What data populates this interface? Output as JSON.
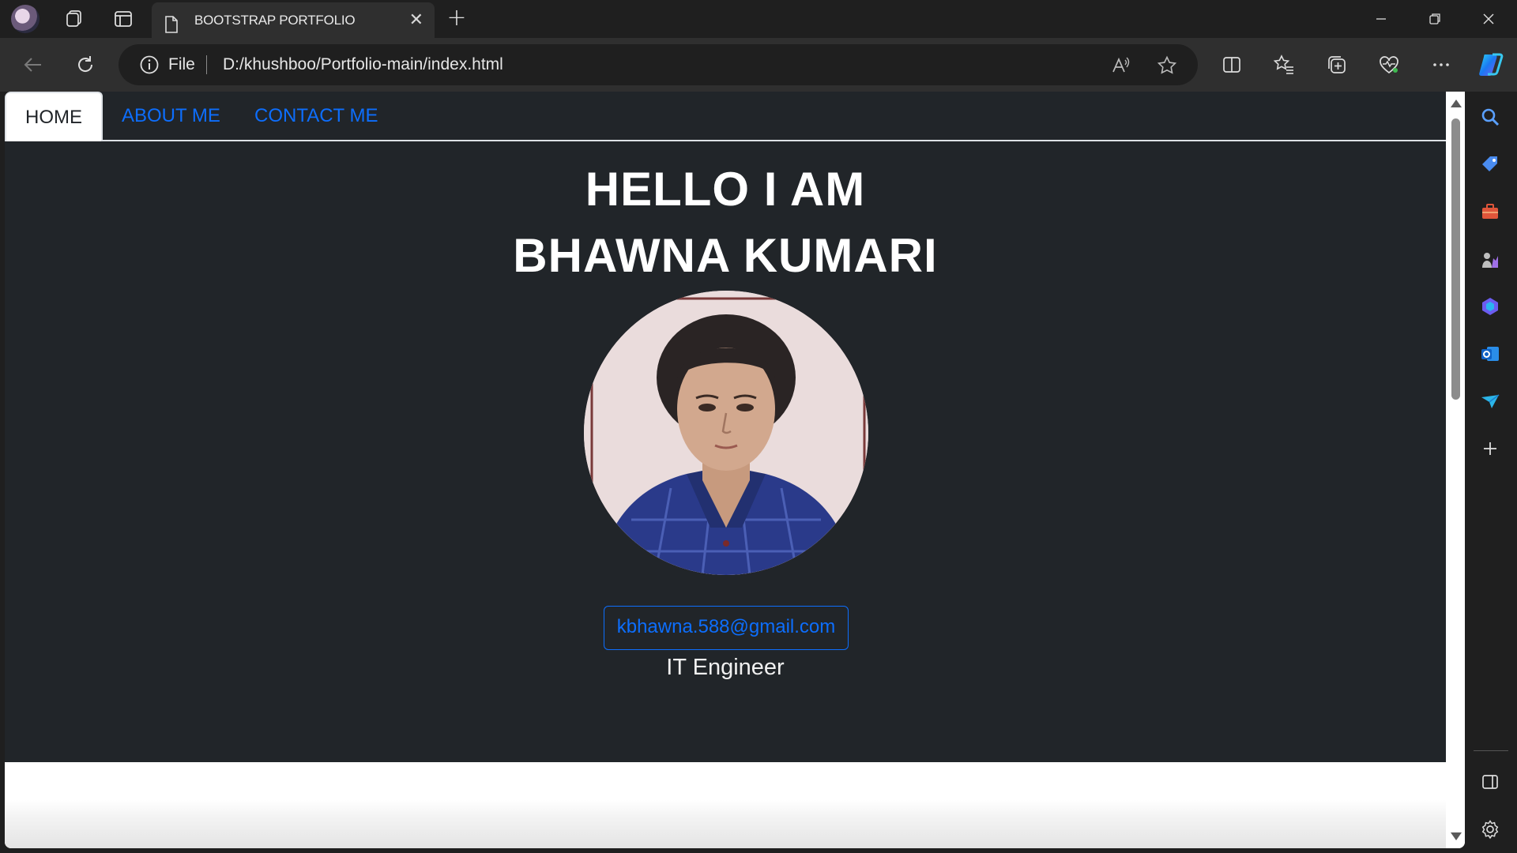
{
  "browser": {
    "tab": {
      "title": "BOOTSTRAP PORTFOLIO",
      "close_glyph": "✕",
      "icon": "page-icon"
    },
    "new_tab_glyph": "+",
    "address": {
      "scheme_label": "File",
      "url": "D:/khushboo/Portfolio-main/index.html"
    },
    "toolbar_icons": [
      "back-icon",
      "refresh-icon",
      "read-aloud-icon",
      "favorite-star-icon",
      "split-screen-icon",
      "favorites-icon",
      "collections-icon",
      "browser-essentials-icon",
      "more-icon",
      "copilot-icon"
    ],
    "sidebar_icons": [
      "search-icon",
      "shopping-icon",
      "tools-icon",
      "games-icon",
      "microsoft-365-icon",
      "outlook-icon",
      "drop-icon",
      "add-icon",
      "hide-sidebar-icon",
      "settings-icon"
    ],
    "window_controls": [
      "minimize",
      "restore",
      "close"
    ]
  },
  "page": {
    "nav": [
      {
        "label": "HOME",
        "active": true
      },
      {
        "label": "ABOUT ME",
        "active": false
      },
      {
        "label": "CONTACT ME",
        "active": false
      }
    ],
    "hero": {
      "line1": "HELLO I AM",
      "line2": "BHAWNA KUMARI",
      "email": "kbhawna.588@gmail.com",
      "role": "IT Engineer"
    }
  },
  "colors": {
    "hero_bg": "#212529",
    "link": "#0d6efd",
    "browser_chrome": "#1f1f1f",
    "toolbar": "#2f2f2f"
  }
}
